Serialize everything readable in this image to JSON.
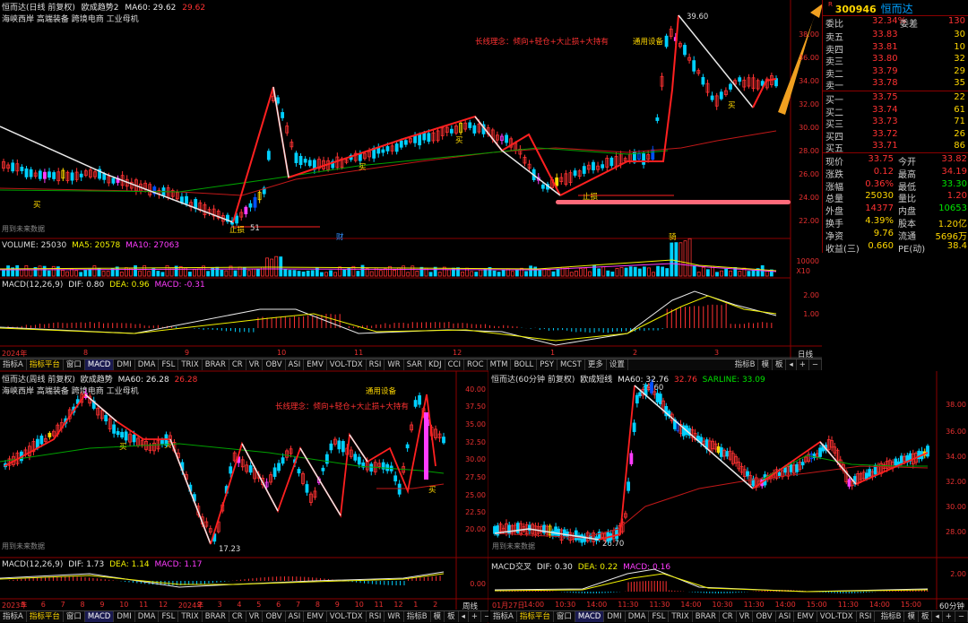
{
  "top_chart": {
    "title": "恒而达(日线 前复权)",
    "indicator": "欧成趋势2",
    "ma60_label": "MA60: 29.62",
    "ma60_value": "29.62",
    "tags": "海峡西岸 高端装备 跨境电商 工业母机",
    "annotation_concept": "长线理念：倾向+轻仓+大止损+大持有",
    "annotation_sector": "通用设备",
    "peak_label": "39.60",
    "stop_label1": "止损",
    "low_label1": "51",
    "stop_label2": "止损",
    "buy_label": "买",
    "future_label": "用到未来数据",
    "marker_cai": "财",
    "marker_qi": "骑",
    "y_ticks": [
      "38.00",
      "36.00",
      "34.00",
      "32.00",
      "30.00",
      "28.00",
      "26.00",
      "24.00",
      "22.00"
    ],
    "volume_header": "VOLUME: 25030",
    "ma5_label": "MA5: 20578",
    "ma10_label": "MA10: 27063",
    "vol_ticks": [
      "10000",
      "X10"
    ],
    "macd_header": "MACD(12,26,9)",
    "dif_label": "DIF: 0.80",
    "dea_label": "DEA: 0.96",
    "macd_label": "MACD: -0.31",
    "macd_ticks": [
      "2.00",
      "1.00"
    ],
    "x_ticks": [
      "2024年",
      "8",
      "9",
      "10",
      "11",
      "12",
      "1",
      "2",
      "3"
    ],
    "period": "日线"
  },
  "toolbar_items": [
    "指标A",
    "指标平台",
    "窗口",
    "MACD",
    "DMI",
    "DMA",
    "FSL",
    "TRIX",
    "BRAR",
    "CR",
    "VR",
    "OBV",
    "ASI",
    "EMV",
    "VOL-TDX",
    "RSI",
    "WR",
    "SAR",
    "KDJ",
    "CCI",
    "ROC",
    "MTM",
    "BOLL",
    "PSY",
    "MCST",
    "更多",
    "设置"
  ],
  "toolbar_right": [
    "指标B",
    "模",
    "板"
  ],
  "quote": {
    "code": "300946",
    "name": "恒而达",
    "r_mark": "R",
    "wb_label": "委比",
    "wb_value": "32.34%",
    "wc_label": "委差",
    "wc_value": "130",
    "asks": [
      {
        "label": "卖五",
        "price": "33.83",
        "vol": "30"
      },
      {
        "label": "卖四",
        "price": "33.81",
        "vol": "10"
      },
      {
        "label": "卖三",
        "price": "33.80",
        "vol": "32"
      },
      {
        "label": "卖二",
        "price": "33.79",
        "vol": "29"
      },
      {
        "label": "卖一",
        "price": "33.78",
        "vol": "35"
      }
    ],
    "bids": [
      {
        "label": "买一",
        "price": "33.75",
        "vol": "22"
      },
      {
        "label": "买二",
        "price": "33.74",
        "vol": "61"
      },
      {
        "label": "买三",
        "price": "33.73",
        "vol": "71"
      },
      {
        "label": "买四",
        "price": "33.72",
        "vol": "26"
      },
      {
        "label": "买五",
        "price": "33.71",
        "vol": "86"
      }
    ],
    "stats": [
      {
        "l1": "现价",
        "v1": "33.75",
        "l2": "今开",
        "v2": "33.82"
      },
      {
        "l1": "涨跌",
        "v1": "0.12",
        "l2": "最高",
        "v2": "34.19"
      },
      {
        "l1": "涨幅",
        "v1": "0.36%",
        "l2": "最低",
        "v2": "33.30"
      },
      {
        "l1": "总量",
        "v1": "25030",
        "l2": "量比",
        "v2": "1.20"
      },
      {
        "l1": "外盘",
        "v1": "14377",
        "l2": "内盘",
        "v2": "10653"
      },
      {
        "l1": "换手",
        "v1": "4.39%",
        "l2": "股本",
        "v2": "1.20亿"
      },
      {
        "l1": "净资",
        "v1": "9.76",
        "l2": "流通",
        "v2": "5696万"
      },
      {
        "l1": "收益(三)",
        "v1": "0.660",
        "l2": "PE(动)",
        "v2": "38.4"
      }
    ]
  },
  "weekly_chart": {
    "title": "恒而达(周线 前复权)",
    "indicator": "欧成趋势",
    "ma60_label": "MA60: 26.28",
    "ma60_value": "26.28",
    "tags": "海峡西岸 高端装备 跨境电商 工业母机",
    "annotation_sector": "通用设备",
    "annotation_concept": "长线理念：倾向+轻仓+大止损+大持有",
    "low_label": "17.23",
    "buy_label": "买",
    "future_label": "用到未来数据",
    "y_ticks": [
      "40.00",
      "37.50",
      "35.00",
      "32.50",
      "30.00",
      "27.50",
      "25.00",
      "22.50",
      "20.00"
    ],
    "macd_header": "MACD(12,26,9)",
    "dif_label": "DIF: 1.73",
    "dea_label": "DEA: 1.14",
    "macd_label": "MACD: 1.17",
    "macd_tick": "0.00",
    "x_ticks": [
      "2023年",
      "5",
      "6",
      "7",
      "8",
      "9",
      "10",
      "11",
      "12",
      "2024年",
      "2",
      "3",
      "4",
      "5",
      "6",
      "7",
      "8",
      "9",
      "10",
      "11",
      "12",
      "1",
      "2"
    ],
    "period": "周线"
  },
  "min60_chart": {
    "title": "恒而达(60分钟 前复权)",
    "indicator": "欧成短线",
    "ma60_label": "MA60: 32.76",
    "ma60_value": "32.76",
    "sar_label": "SARLINE: 33.09",
    "peak_label": "39.60",
    "low_label": "26.70",
    "future_label": "用到未来数据",
    "y_ticks": [
      "38.00",
      "36.00",
      "34.00",
      "32.00",
      "30.00",
      "28.00"
    ],
    "macd_header": "MACD交叉",
    "dif_label": "DIF: 0.30",
    "dea_label": "DEA: 0.22",
    "macd_label": "MACD: 0.16",
    "macd_tick": "2.00",
    "x_ticks": [
      "01月27日",
      "14:00",
      "10:30",
      "14:00",
      "11:30",
      "11:30",
      "14:00",
      "10:30",
      "11:30",
      "14:00",
      "15:00",
      "11:30",
      "14:00",
      "15:00"
    ],
    "period": "60分钟"
  },
  "colors": {
    "up": "#ff3232",
    "down": "#00d0ff",
    "bg": "#000000",
    "axis": "#8b0000",
    "ma60": "#00a000"
  }
}
